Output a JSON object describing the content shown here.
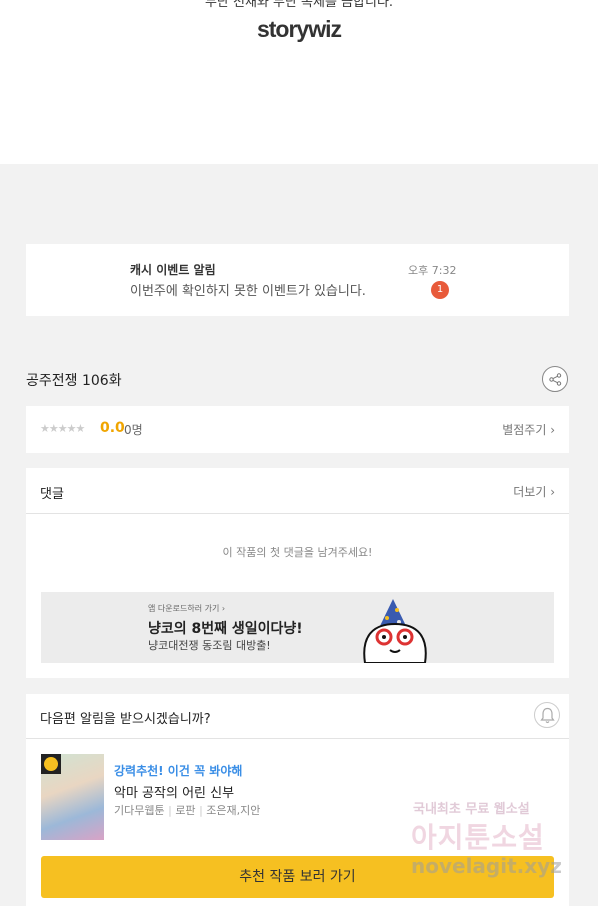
{
  "header": {
    "notice_text": "무단 전재와 무단 복제를 금합니다.",
    "logo": "storywiz"
  },
  "notification": {
    "title": "캐시 이벤트 알림",
    "message": "이번주에 확인하지 못한 이벤트가 있습니다.",
    "time": "오후 7:32",
    "badge": "1"
  },
  "episode": {
    "title": "공주전쟁 106화"
  },
  "rating": {
    "stars": "★★★★★",
    "score": "0.0",
    "count": "0명",
    "rate_label": "별점주기 ›"
  },
  "comments": {
    "header": "댓글",
    "more_label": "더보기 ›",
    "empty_message": "이 작품의 첫 댓글을 남겨주세요!",
    "banner": {
      "small": "앱 다운로드하러 가기 ›",
      "title": "냥코의 8번째 생일이다냥!",
      "subtitle": "냥코대전쟁 동조림 대방출!"
    }
  },
  "subscribe": {
    "question": "다음편 알림을 받으시겠습니까?",
    "recommend_tag": "강력추천! 이건 꼭 봐야해",
    "work_title": "악마 공작의 어린 신부",
    "meta": [
      "기다무웹툰",
      "로판",
      "조은재,지안"
    ],
    "button_label": "추천 작품 보러 가기"
  },
  "watermark": {
    "line1": "국내최초 무료 웹소설",
    "line2": "아지툰소설",
    "line3": "novelagit.xyz"
  },
  "colors": {
    "accent": "#f6c021",
    "score": "#f0a500",
    "badge": "#e85a3a",
    "recommend": "#3a8ee6"
  }
}
